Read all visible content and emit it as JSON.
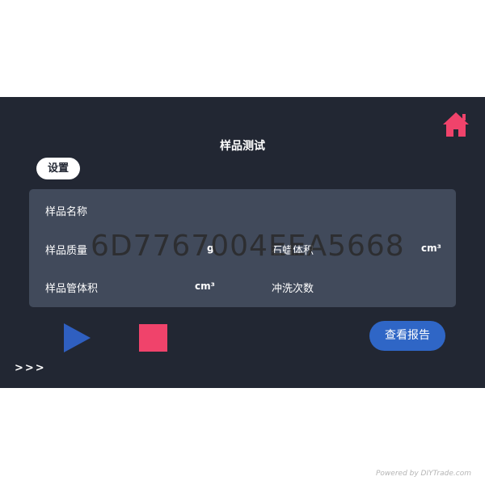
{
  "header": {
    "title": "样品测试"
  },
  "icons": {
    "home": "home-icon",
    "play": "play-icon",
    "stop": "stop-icon"
  },
  "colors": {
    "background": "#222733",
    "panel": "#414a5b",
    "home": "#f0436b",
    "play": "#2f5fc0",
    "stop": "#f0436b",
    "report": "#2f66c6"
  },
  "settings_button": {
    "label": "设置"
  },
  "form": {
    "sample_name": {
      "label": "样品名称",
      "value": ""
    },
    "sample_mass": {
      "label": "样品质量",
      "unit": "g",
      "value": ""
    },
    "wax_volume": {
      "label": "石蜡体积",
      "unit": "cm³",
      "value": ""
    },
    "tube_volume": {
      "label": "样品管体积",
      "unit": "cm³",
      "value": ""
    },
    "wash_count": {
      "label": "冲洗次数",
      "value": ""
    }
  },
  "report_button": {
    "label": "查看报告"
  },
  "more": {
    "label": ">>>"
  },
  "watermark": {
    "text": "6D7767004EEA5668"
  },
  "footer": {
    "credit": "Powered by DIYTrade.com"
  }
}
